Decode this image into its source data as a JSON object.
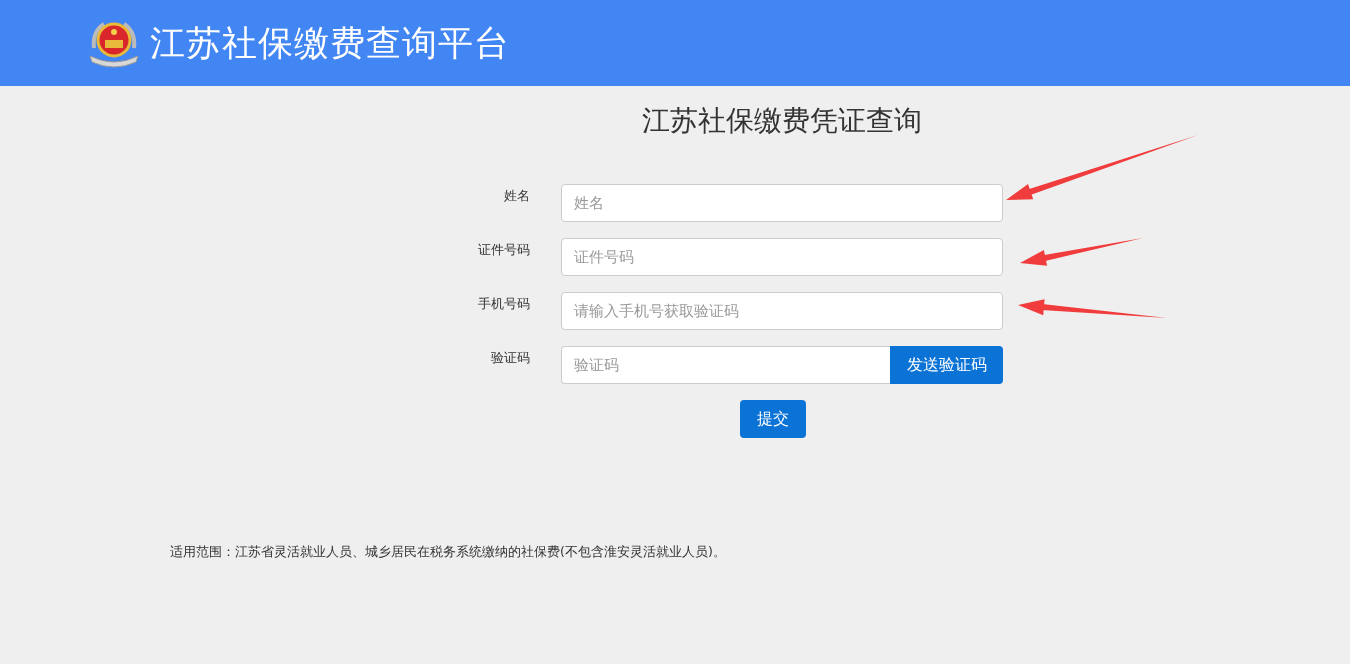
{
  "header": {
    "title": "江苏社保缴费查询平台"
  },
  "page_title": "江苏社保缴费凭证查询",
  "fields": [
    {
      "kind": "text",
      "label": "姓名",
      "placeholder": "姓名"
    },
    {
      "kind": "text",
      "label": "证件号码",
      "placeholder": "证件号码"
    },
    {
      "kind": "text",
      "label": "手机号码",
      "placeholder": "请输入手机号获取验证码"
    },
    {
      "kind": "with-button",
      "label": "验证码",
      "placeholder": "验证码",
      "button": "发送验证码"
    }
  ],
  "submit": "提交",
  "note": "适用范围：江苏省灵活就业人员、城乡居民在税务系统缴纳的社保费(不包含淮安灵活就业人员)。"
}
